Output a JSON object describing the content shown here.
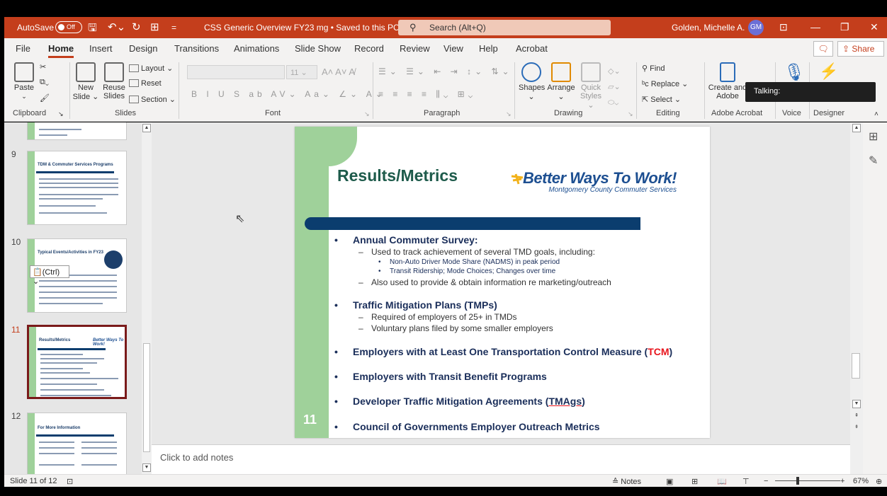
{
  "titlebar": {
    "autosave_label": "AutoSave",
    "autosave_state": "Off",
    "doc_title": "CSS Generic Overview FY23 mg • Saved to this PC ⌄",
    "search_placeholder": "Search (Alt+Q)",
    "user_name": "Golden, Michelle A.",
    "user_initials": "GM",
    "accent": "#c43e1c"
  },
  "ribbon": {
    "tabs": [
      "File",
      "Home",
      "Insert",
      "Design",
      "Transitions",
      "Animations",
      "Slide Show",
      "Record",
      "Review",
      "View",
      "Help",
      "Acrobat"
    ],
    "share_label": "Share",
    "clipboard": {
      "paste": "Paste",
      "group": "Clipboard"
    },
    "slides": {
      "new_slide_1": "New",
      "new_slide_2": "Slide ⌄",
      "reuse_1": "Reuse",
      "reuse_2": "Slides",
      "layout": "Layout ⌄",
      "reset": "Reset",
      "section": "Section ⌄",
      "group": "Slides"
    },
    "font": {
      "size": "11",
      "group": "Font"
    },
    "paragraph": {
      "group": "Paragraph"
    },
    "drawing": {
      "shapes": "Shapes",
      "arrange": "Arrange",
      "quick_1": "Quick",
      "quick_2": "Styles ⌄",
      "group": "Drawing"
    },
    "editing": {
      "find": "Find",
      "replace": "Replace ⌄",
      "select": "Select ⌄",
      "group": "Editing"
    },
    "acrobat": {
      "create_1": "Create and",
      "create_2": "Adobe",
      "group": "Adobe Acrobat"
    },
    "voice": {
      "group": "Voice"
    },
    "designer": {
      "group": "Designer"
    },
    "talking_tip": "Talking:"
  },
  "slides_panel": {
    "items": [
      {
        "num": "9",
        "title": "TDM & Commuter Services Programs"
      },
      {
        "num": "10",
        "title": "Typical Events/Activities in FY23"
      },
      {
        "num": "11",
        "title": "Results/Metrics"
      },
      {
        "num": "12",
        "title": "For More Information"
      }
    ],
    "paste_tag": "(Ctrl) ⌄",
    "selected": "11"
  },
  "slide": {
    "title": "Results/Metrics",
    "logo_main": "Better Ways To Work!",
    "logo_sub": "Montgomery County Commuter Services",
    "number": "11",
    "bullets": {
      "b1": "Annual Commuter Survey:",
      "b1_s1": "Used to track achievement of several TMD goals, including:",
      "b1_s1_a": "Non-Auto Driver Mode Share (NADMS) in peak period",
      "b1_s1_b": "Transit Ridership; Mode Choices; Changes over time",
      "b1_s2": "Also used to provide & obtain information re marketing/outreach",
      "b2": "Traffic Mitigation Plans (TMPs)",
      "b2_s1": "Required of employers of 25+ in TMDs",
      "b2_s2": "Voluntary plans filed by some smaller employers",
      "b3_pre": "Employers with at Least One Transportation Control Measure (",
      "b3_red": "TCM",
      "b3_post": ")",
      "b4": "Employers with Transit Benefit Programs",
      "b5_pre": "Developer Traffic Mitigation Agreements (",
      "b5_u": "TMAgs",
      "b5_post": ")",
      "b6": "Council of Governments Employer Outreach Metrics"
    }
  },
  "notes_placeholder": "Click to add notes",
  "status": {
    "slide_info": "Slide 11 of 12",
    "notes": "Notes",
    "zoom": "67%"
  }
}
